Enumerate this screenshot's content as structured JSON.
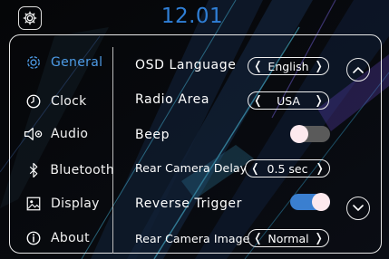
{
  "header": {
    "time": "12.01",
    "settings_icon": "gear-icon"
  },
  "nav": {
    "items": [
      {
        "label": "General",
        "icon": "gear-icon",
        "active": true
      },
      {
        "label": "Clock",
        "icon": "clock-icon",
        "active": false
      },
      {
        "label": "Audio",
        "icon": "speaker-icon",
        "active": false
      },
      {
        "label": "Bluetooth",
        "icon": "bluetooth-icon",
        "active": false
      },
      {
        "label": "Display",
        "icon": "display-icon",
        "active": false
      },
      {
        "label": "About",
        "icon": "info-icon",
        "active": false
      }
    ]
  },
  "settings": {
    "osd_language": {
      "label": "OSD Language",
      "value": "English"
    },
    "radio_area": {
      "label": "Radio Area",
      "value": "USA"
    },
    "beep": {
      "label": "Beep",
      "on": false
    },
    "rear_camera_delay": {
      "label": "Rear Camera Delay",
      "value": "0.5 sec"
    },
    "reverse_trigger": {
      "label": "Reverse Trigger",
      "on": true
    },
    "rear_camera_image": {
      "label": "Rear Camera Image",
      "value": "Normal"
    }
  },
  "colors": {
    "accent": "#4d9be6",
    "clock": "#2f7fd6",
    "toggle_on": "#3a7fd0",
    "toggle_off": "#5a5a5a"
  }
}
